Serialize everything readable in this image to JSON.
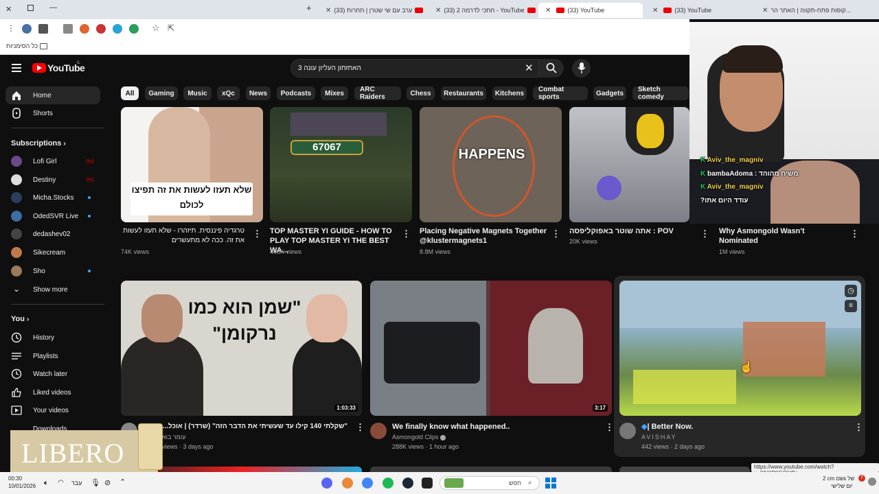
{
  "browser": {
    "tabs": [
      {
        "title": "קופות פתח-תקווה | האתר הר..."
      },
      {
        "title": "(33) YouTube"
      },
      {
        "title": "(33) YouTube"
      },
      {
        "title": "(33) חתכי לדרמה 2 - YouTube"
      },
      {
        "title": "(33) ערב עם שי שטרן | תחרות"
      }
    ],
    "bookmarks_label": "כל הסימניות",
    "status_url": "https://www.youtube.com/watch?v=CNXP0GO6tRc"
  },
  "header": {
    "logo_text": "YouTube",
    "country_code": "IL",
    "search_value": "האחזחון העליון עונה 3"
  },
  "chips": [
    "All",
    "Gaming",
    "Music",
    "xQc",
    "News",
    "Podcasts",
    "Mixes",
    "ARC Raiders",
    "Chess",
    "Restaurants",
    "Kitchens",
    "Combat sports",
    "Gadgets",
    "Sketch comedy"
  ],
  "sidebar": {
    "home": "Home",
    "shorts": "Shorts",
    "subscriptions_heading": "Subscriptions",
    "subscriptions": [
      {
        "name": "Lofi Girl",
        "status": "live"
      },
      {
        "name": "Destiny",
        "status": "live"
      },
      {
        "name": "Micha.Stocks",
        "status": "new"
      },
      {
        "name": "OdedSVR Live",
        "status": "new"
      },
      {
        "name": "dedashev02",
        "status": ""
      },
      {
        "name": "Sikecream",
        "status": ""
      },
      {
        "name": "Sho",
        "status": "new"
      }
    ],
    "show_more": "Show more",
    "you_heading": "You",
    "you_items": [
      "History",
      "Playlists",
      "Watch later",
      "Liked videos",
      "Your videos",
      "Downloads"
    ]
  },
  "videos_row1": [
    {
      "title": "טרגדיה פיננסית. תיזהרו - שלא תעזו לעשות את זה. ככה לא מתעשרים",
      "meta": "74K views",
      "thumb_text": "שלא תעזו לעשות את זה תפיצו לכולם"
    },
    {
      "title": "TOP MASTER YI GUIDE - HOW TO PLAY TOP MASTER YI THE BEST WA...",
      "meta": "408K views",
      "thumb_text": "67067"
    },
    {
      "title": "Placing Negative Magnets Together @klustermagnets1",
      "meta": "8.8M views",
      "thumb_text": "HAPPENS"
    },
    {
      "title": "POV : אתה שוטר באפוקליפסה",
      "meta": "20K views",
      "thumb_text": ""
    },
    {
      "title": "Why Asmongold Wasn't Nominated",
      "meta": "1M views",
      "thumb_text": ""
    }
  ],
  "videos_row2": [
    {
      "title": "\"שקלתי 140 קילו עד שעשיתי את הדבר הזה\" (שרדר) | אוכל...",
      "channel": "עומר בוא",
      "meta": "views · 3 days ago",
      "duration": "1:03:33",
      "thumb_text": "\"שמן הוא כמו נרקומן\""
    },
    {
      "title": "We finally know what happened..",
      "channel": "Asmongold Clips",
      "meta": "288K views · 1 hour ago",
      "duration": "3:17",
      "thumb_text": ""
    },
    {
      "title": "| Better Now.",
      "channel": "AVISHAY",
      "meta": "442 views · 2 days ago",
      "duration": "",
      "thumb_text": ""
    }
  ],
  "overlay": {
    "ad_text": "LIBERO"
  },
  "webcam_chat": [
    {
      "user": "Aviv_the_magniv",
      "msg": ""
    },
    {
      "user": "bambaAdoma",
      "msg": "משיח מהוהד"
    },
    {
      "user": "Aviv_the_magniv",
      "msg": ""
    },
    {
      "user": "",
      "msg": "?עודד היום אתו"
    }
  ],
  "taskbar": {
    "search_placeholder": "חפש",
    "lang": "עבר",
    "time": "00:30",
    "date": "10/01/2026",
    "weather": "2 cm של גשם",
    "weather_sub": "יום שלישי",
    "notification_count": "7"
  },
  "colors": {
    "yt_red": "#ff0000",
    "bg": "#0f0f0f",
    "chip_bg": "#272727",
    "accent_blue": "#3ea6ff"
  }
}
